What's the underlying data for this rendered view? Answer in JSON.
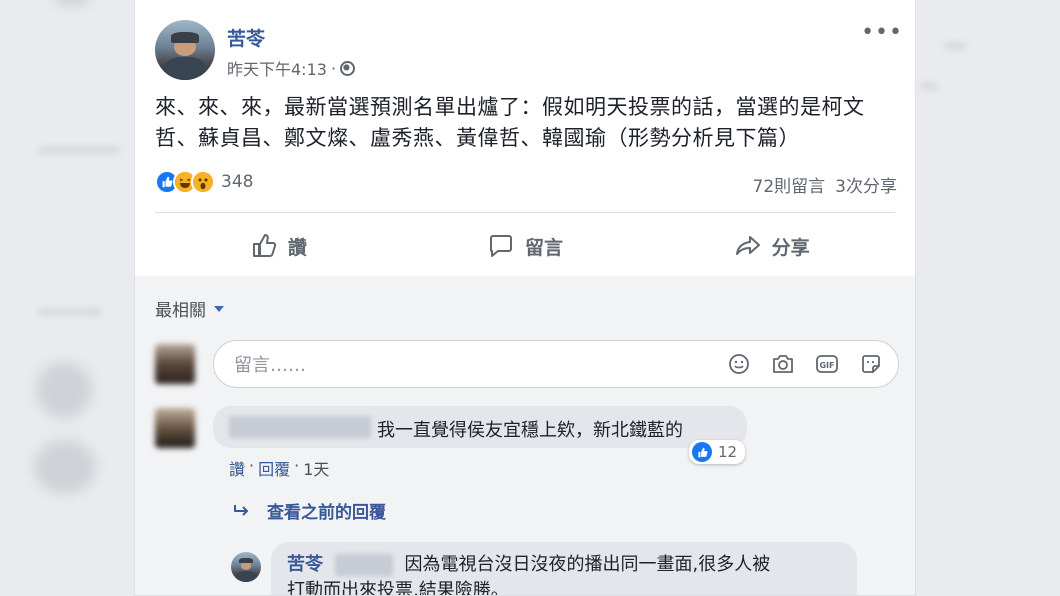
{
  "post": {
    "author": "苦苓",
    "timestamp": "昨天下午4:13",
    "separator": "·",
    "text": "來、來、來，最新當選預測名單出爐了：假如明天投票的話，當選的是柯文哲、蘇貞昌、鄭文燦、盧秀燕、黃偉哲、韓國瑜（形勢分析見下篇）",
    "more": "•••",
    "reaction_count": "348",
    "comments_count": "72則留言",
    "shares_count": "3次分享"
  },
  "actions": {
    "like": "讚",
    "comment": "留言",
    "share": "分享"
  },
  "comments": {
    "sort_label": "最相關",
    "input_placeholder": "留言……",
    "first": {
      "text": "我一直覺得侯友宜穩上欸，新北鐵藍的",
      "likes": "12",
      "like_action": "讚",
      "reply_action": "回覆",
      "dot": "·",
      "time": "1天"
    },
    "view_previous": "查看之前的回覆",
    "reply": {
      "author": "苦苓",
      "text_line1": "因為電視台沒日沒夜的播出同一畫面,很多人被",
      "text_line2": "打動而出來投票,結果險勝。"
    }
  },
  "icons": {
    "like": "thumbs-up-icon",
    "comment": "speech-bubble-icon",
    "share": "share-arrow-icon",
    "emoji": "smiley-icon",
    "camera": "camera-icon",
    "gif": "gif-icon",
    "sticker": "sticker-icon",
    "globe": "globe-icon"
  },
  "colors": {
    "link_blue": "#385898",
    "like_blue": "#1877f2",
    "page_bg": "#e9ebee"
  }
}
